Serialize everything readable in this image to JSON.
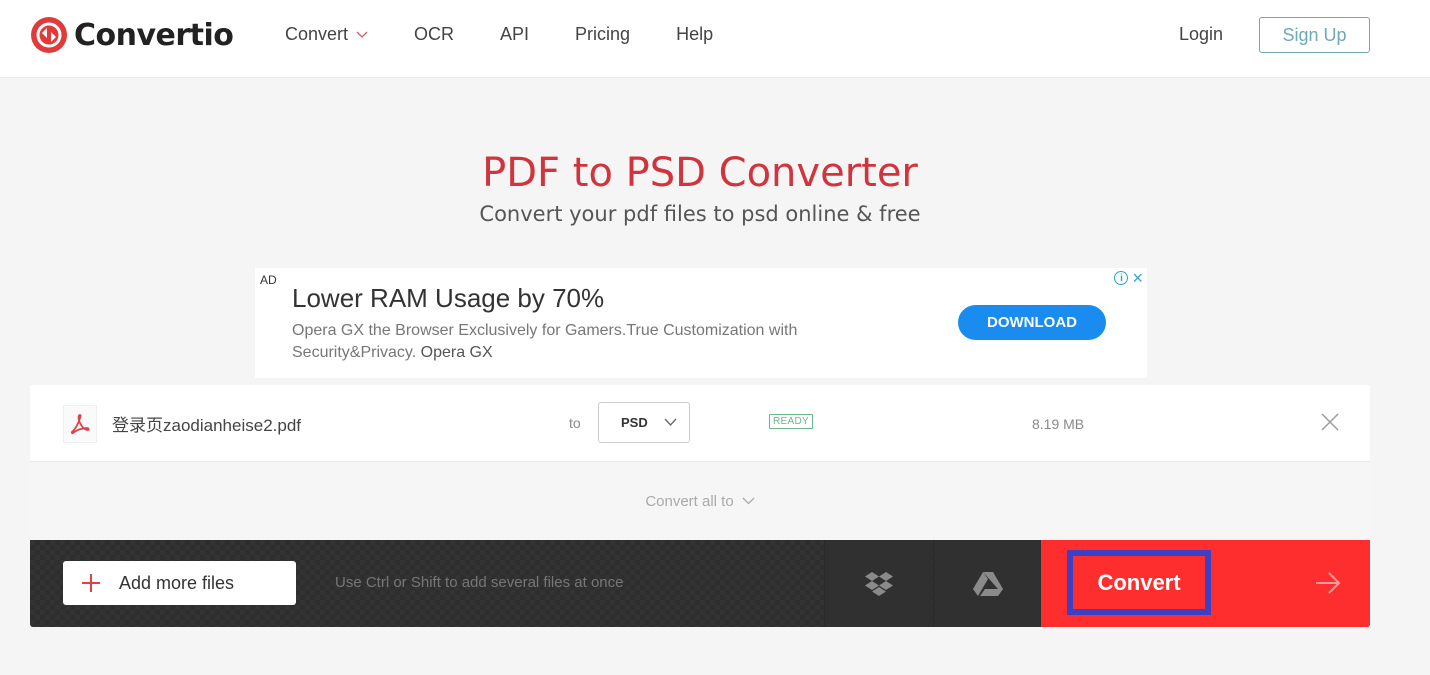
{
  "header": {
    "logo_text": "Convertio",
    "nav": [
      {
        "label": "Convert",
        "has_dropdown": true
      },
      {
        "label": "OCR"
      },
      {
        "label": "API"
      },
      {
        "label": "Pricing"
      },
      {
        "label": "Help"
      }
    ],
    "login_label": "Login",
    "signup_label": "Sign Up"
  },
  "hero": {
    "title": "PDF to PSD Converter",
    "subtitle": "Convert your pdf files to psd online & free"
  },
  "ad": {
    "label": "AD",
    "title": "Lower RAM Usage by 70%",
    "description": "Opera GX the Browser Exclusively for Gamers.True Customization with Security&Privacy.",
    "brand": "Opera GX",
    "button_label": "DOWNLOAD",
    "info_icon": "i",
    "close_icon": "×"
  },
  "file": {
    "name": "登录页zaodianheise2.pdf",
    "to_label": "to",
    "format": "PSD",
    "status": "READY",
    "size": "8.19 MB"
  },
  "convert_all": {
    "label": "Convert all to"
  },
  "actions": {
    "add_files_label": "Add more files",
    "hint": "Use Ctrl or Shift to add several files at once",
    "convert_label": "Convert"
  },
  "colors": {
    "brand_red": "#d0343d",
    "convert_bg": "#ff2e2e",
    "highlight_border": "#3d3fc4",
    "ad_button": "#1a8cf0",
    "status_green": "#68b88a"
  }
}
